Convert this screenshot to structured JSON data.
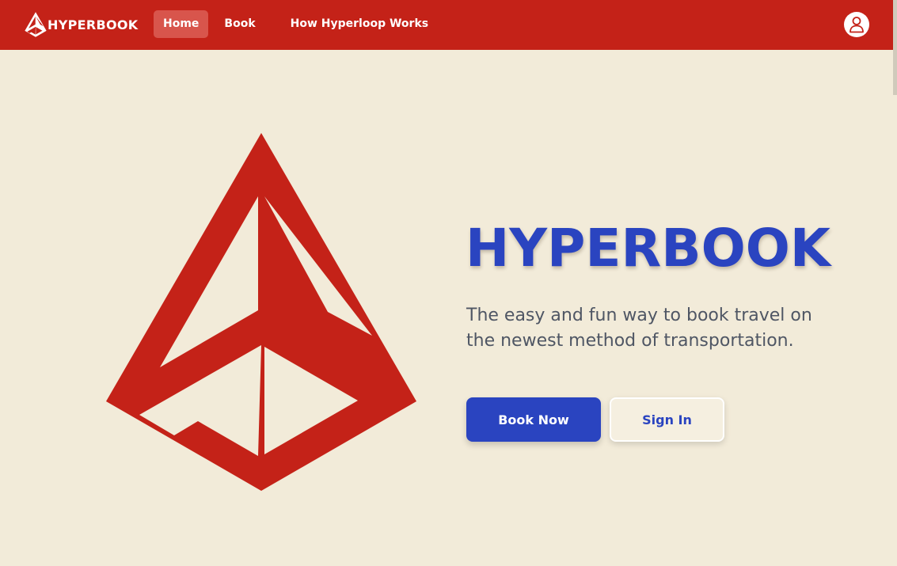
{
  "brand": {
    "name": "HYPERBOOK",
    "logo_icon": "hyperbook-pyramid-icon"
  },
  "nav": {
    "items": [
      {
        "label": "Home",
        "active": true
      },
      {
        "label": "Book",
        "active": false
      },
      {
        "label": "How Hyperloop Works",
        "active": false
      }
    ],
    "profile_icon": "user-icon"
  },
  "hero": {
    "title": "HYPERBOOK",
    "subtitle": "The easy and fun way to book travel on the newest method of transportation.",
    "primary_button": "Book Now",
    "secondary_button": "Sign In",
    "logo_icon": "hyperbook-pyramid-icon"
  },
  "colors": {
    "brand_red": "#c42218",
    "accent_blue": "#2a44c0",
    "background": "#f2ebd9"
  }
}
